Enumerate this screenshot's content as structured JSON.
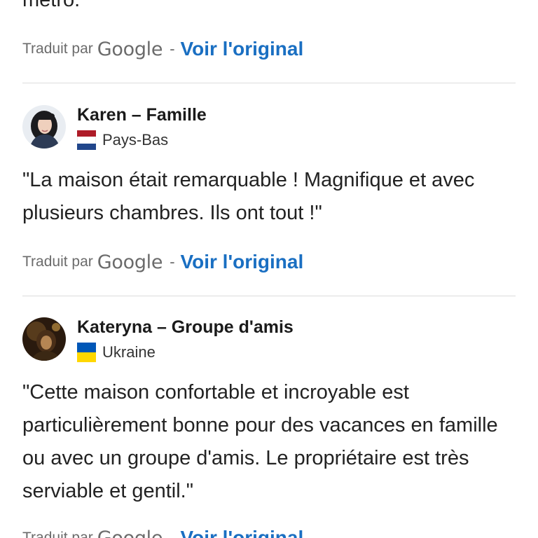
{
  "top_partial_text": "métro.",
  "translation": {
    "by_label": "Traduit par",
    "google_logo_text": "Google",
    "separator": "-",
    "see_original_label": "Voir l'original"
  },
  "reviews": [
    {
      "name": "Karen – Famille",
      "country": "Pays-Bas",
      "flag_icon": "netherlands-flag-icon",
      "flag_colors": [
        "#ae1c28",
        "#ffffff",
        "#21468b"
      ],
      "text": "\"La maison était remarquable ! Magnifique et avec plusieurs chambres. Ils ont tout !\""
    },
    {
      "name": "Kateryna – Groupe d'amis",
      "country": "Ukraine",
      "flag_icon": "ukraine-flag-icon",
      "flag_colors": [
        "#0057b7",
        "#ffd700"
      ],
      "text": "\"Cette maison confortable et incroyable est particulièrement bonne pour des vacances en famille ou avec un groupe d'amis. Le propriétaire est très serviable et gentil.\""
    }
  ],
  "colors": {
    "link": "#1a6fc2",
    "divider": "#dcdcdc",
    "muted_text": "#6b6b6b"
  }
}
